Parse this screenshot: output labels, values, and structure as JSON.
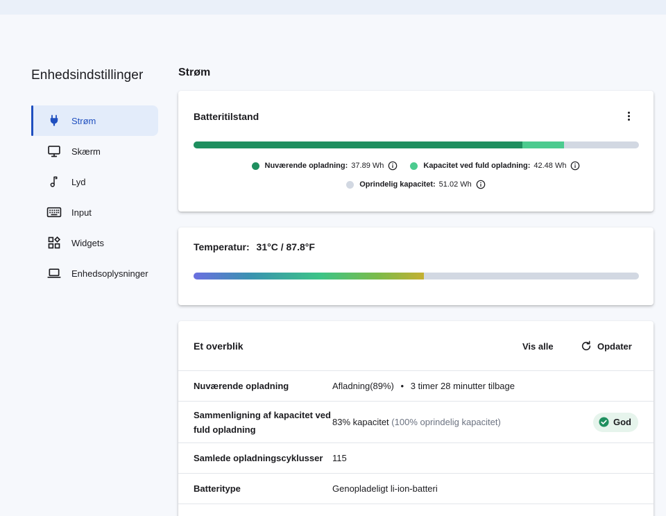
{
  "app_title": "Enhedsindstillinger",
  "nav": {
    "items": [
      {
        "label": "Strøm",
        "icon": "plug-icon",
        "active": true
      },
      {
        "label": "Skærm",
        "icon": "monitor-icon"
      },
      {
        "label": "Lyd",
        "icon": "music-note-icon"
      },
      {
        "label": "Input",
        "icon": "keyboard-icon"
      },
      {
        "label": "Widgets",
        "icon": "widgets-icon"
      },
      {
        "label": "Enhedsoplysninger",
        "icon": "laptop-icon"
      }
    ]
  },
  "section_title": "Strøm",
  "battery": {
    "title": "Batteritilstand",
    "current_fraction": 0.739,
    "full_fraction": 0.832,
    "legend": {
      "current": {
        "label": "Nuværende opladning:",
        "value": "37.89 Wh",
        "color": "#1f8f5f"
      },
      "full": {
        "label": "Kapacitet ved fuld opladning:",
        "value": "42.48 Wh",
        "color": "#4ccb8f"
      },
      "original": {
        "label": "Oprindelig kapacitet:",
        "value": "51.02 Wh",
        "color": "#d2d8e2"
      }
    }
  },
  "temperature": {
    "label": "Temperatur:",
    "value": "31°C / 87.8°F",
    "fraction": 0.517
  },
  "overview": {
    "title": "Et overblik",
    "view_all": "Vis alle",
    "refresh": "Opdater",
    "rows": {
      "charge": {
        "key": "Nuværende opladning",
        "value": "Afladning(89%)",
        "sep": "•",
        "extra": "3 timer 28 minutter tilbage"
      },
      "capacity": {
        "key": "Sammenligning af kapacitet ved fuld opladning",
        "value": "83% kapacitet",
        "extra": "(100% oprindelig kapacitet)",
        "badge": "God"
      },
      "cycles": {
        "key": "Samlede opladningscyklusser",
        "value": "115"
      },
      "type": {
        "key": "Batteritype",
        "value": "Genopladeligt li-ion-batteri"
      }
    }
  },
  "colors": {
    "accent": "#1f4fbf",
    "good": "#1f8f5f"
  }
}
